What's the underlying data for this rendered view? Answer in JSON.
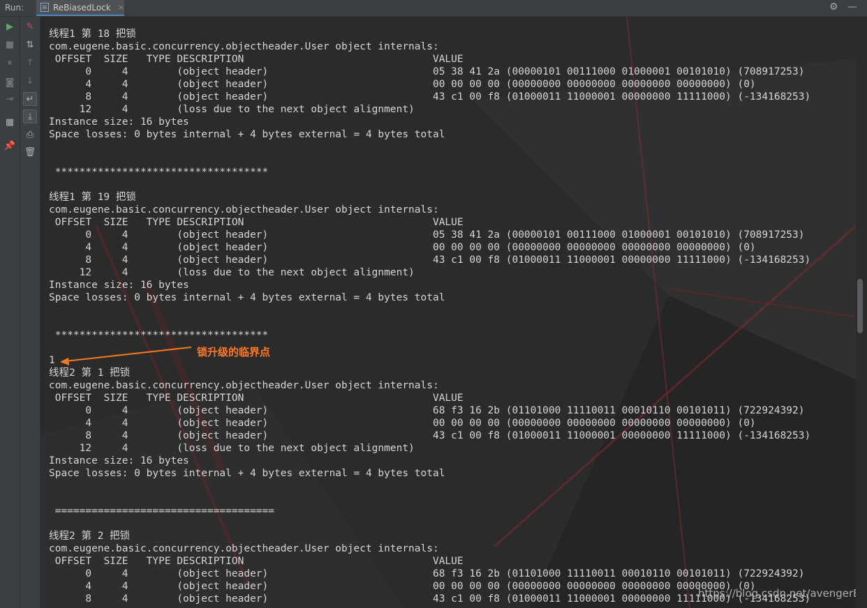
{
  "header": {
    "run_label": "Run:",
    "tab_title": "ReBiasedLock",
    "tab_close": "×",
    "settings_glyph": "⚙",
    "minimize_glyph": "—"
  },
  "toolbar_left": [
    {
      "name": "rerun-icon",
      "glyph": "▶"
    },
    {
      "name": "stop-icon",
      "glyph": "■"
    },
    {
      "name": "pause-icon",
      "glyph": "⏸"
    },
    {
      "name": "camera-icon",
      "glyph": "◙"
    },
    {
      "name": "exit-icon",
      "glyph": "⇥"
    },
    {
      "name": "layout-icon",
      "glyph": "▦"
    },
    {
      "name": "pin-icon",
      "glyph": "📌"
    }
  ],
  "toolbar_right": [
    {
      "name": "edit-icon",
      "glyph": "✎"
    },
    {
      "name": "sort-icon",
      "glyph": "⇅"
    },
    {
      "name": "up-arrow-icon",
      "glyph": "↑"
    },
    {
      "name": "down-arrow-icon",
      "glyph": "↓"
    },
    {
      "name": "soft-wrap-icon",
      "glyph": "↵"
    },
    {
      "name": "scroll-to-end-icon",
      "glyph": "⤓"
    },
    {
      "name": "print-icon",
      "glyph": "⎙"
    },
    {
      "name": "trash-icon",
      "glyph": "🗑"
    }
  ],
  "console": {
    "lines": [
      "线程1 第 18 把锁",
      "com.eugene.basic.concurrency.objectheader.User object internals:",
      " OFFSET  SIZE   TYPE DESCRIPTION                               VALUE",
      "      0     4        (object header)                           05 38 41 2a (00000101 00111000 01000001 00101010) (708917253)",
      "      4     4        (object header)                           00 00 00 00 (00000000 00000000 00000000 00000000) (0)",
      "      8     4        (object header)                           43 c1 00 f8 (01000011 11000001 00000000 11111000) (-134168253)",
      "     12     4        (loss due to the next object alignment)",
      "Instance size: 16 bytes",
      "Space losses: 0 bytes internal + 4 bytes external = 4 bytes total",
      "",
      "",
      " ***********************************",
      "",
      "线程1 第 19 把锁",
      "com.eugene.basic.concurrency.objectheader.User object internals:",
      " OFFSET  SIZE   TYPE DESCRIPTION                               VALUE",
      "      0     4        (object header)                           05 38 41 2a (00000101 00111000 01000001 00101010) (708917253)",
      "      4     4        (object header)                           00 00 00 00 (00000000 00000000 00000000 00000000) (0)",
      "      8     4        (object header)                           43 c1 00 f8 (01000011 11000001 00000000 11111000) (-134168253)",
      "     12     4        (loss due to the next object alignment)",
      "Instance size: 16 bytes",
      "Space losses: 0 bytes internal + 4 bytes external = 4 bytes total",
      "",
      "",
      " ***********************************",
      "",
      "1",
      "线程2 第 1 把锁",
      "com.eugene.basic.concurrency.objectheader.User object internals:",
      " OFFSET  SIZE   TYPE DESCRIPTION                               VALUE",
      "      0     4        (object header)                           68 f3 16 2b (01101000 11110011 00010110 00101011) (722924392)",
      "      4     4        (object header)                           00 00 00 00 (00000000 00000000 00000000 00000000) (0)",
      "      8     4        (object header)                           43 c1 00 f8 (01000011 11000001 00000000 11111000) (-134168253)",
      "     12     4        (loss due to the next object alignment)",
      "Instance size: 16 bytes",
      "Space losses: 0 bytes internal + 4 bytes external = 4 bytes total",
      "",
      "",
      " ====================================",
      "",
      "线程2 第 2 把锁",
      "com.eugene.basic.concurrency.objectheader.User object internals:",
      " OFFSET  SIZE   TYPE DESCRIPTION                               VALUE",
      "      0     4        (object header)                           68 f3 16 2b (01101000 11110011 00010110 00101011) (722924392)",
      "      4     4        (object header)                           00 00 00 00 (00000000 00000000 00000000 00000000) (0)",
      "      8     4        (object header)                           43 c1 00 f8 (01000011 11000001 00000000 11111000) (-134168253)"
    ]
  },
  "annotation": {
    "text": "锁升级的临界点",
    "color": "#ff7a1e"
  },
  "watermark": "https://blog.csdn.net/avengerEug"
}
